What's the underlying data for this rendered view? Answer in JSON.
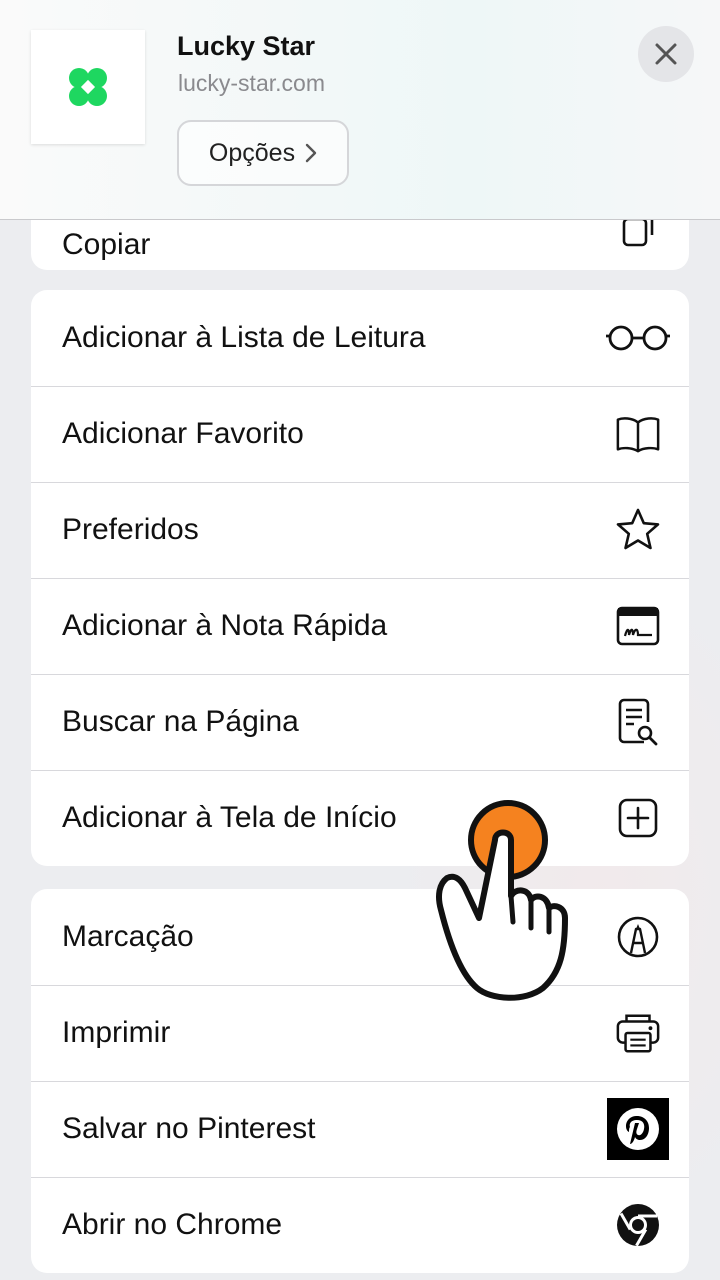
{
  "header": {
    "title": "Lucky Star",
    "url": "lucky-star.com",
    "options_label": "Opções",
    "icon": "lucky-star-clover-icon",
    "accent": "#1ed760"
  },
  "copy_row": {
    "label": "Copiar",
    "icon": "copy-icon"
  },
  "menu_group_1": [
    {
      "label": "Adicionar à Lista de Leitura",
      "icon": "glasses-icon"
    },
    {
      "label": "Adicionar Favorito",
      "icon": "book-icon"
    },
    {
      "label": "Preferidos",
      "icon": "star-icon"
    },
    {
      "label": "Adicionar à Nota Rápida",
      "icon": "quick-note-icon"
    },
    {
      "label": "Buscar na Página",
      "icon": "find-in-page-icon"
    },
    {
      "label": "Adicionar à Tela de Início",
      "icon": "add-square-icon"
    }
  ],
  "menu_group_2": [
    {
      "label": "Marcação",
      "icon": "markup-pen-icon"
    },
    {
      "label": "Imprimir",
      "icon": "printer-icon"
    },
    {
      "label": "Salvar no Pinterest",
      "icon": "pinterest-icon"
    },
    {
      "label": "Abrir no Chrome",
      "icon": "chrome-icon"
    }
  ],
  "tap_indicator": {
    "icon": "tap-hand-icon",
    "color": "#f5821f"
  }
}
